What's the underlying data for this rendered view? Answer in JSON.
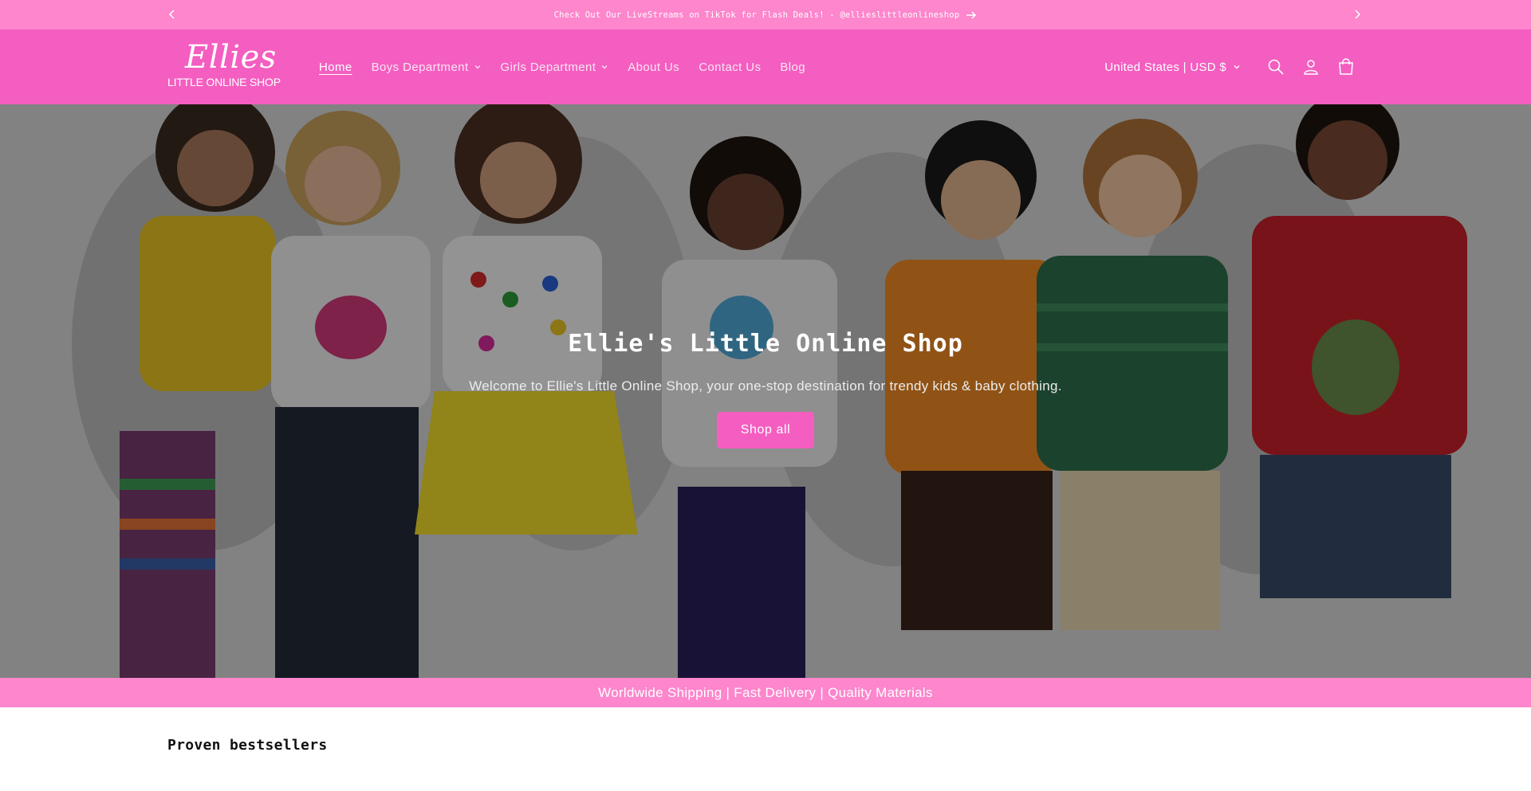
{
  "announcement": {
    "text": "Check Out Our LiveStreams on TikTok for Flash Deals! - @ellieslittleonlineshop",
    "prev_icon": "chevron-left-icon",
    "next_icon": "chevron-right-icon",
    "arrow_icon": "arrow-right-icon"
  },
  "header": {
    "logo_top": "Ellies",
    "logo_bottom": "LITTLE ONLINE SHOP",
    "nav": [
      {
        "label": "Home",
        "active": true
      },
      {
        "label": "Boys Department",
        "dropdown": true
      },
      {
        "label": "Girls Department",
        "dropdown": true
      },
      {
        "label": "About Us"
      },
      {
        "label": "Contact Us"
      },
      {
        "label": "Blog"
      }
    ],
    "locale": "United States | USD $",
    "icons": [
      "search-icon",
      "account-icon",
      "cart-icon"
    ]
  },
  "hero": {
    "title": "Ellie's Little Online Shop",
    "subtitle": "Welcome to Ellie's Little Online Shop, your one-stop destination for trendy kids & baby clothing.",
    "button": "Shop all"
  },
  "strip": {
    "text": "Worldwide Shipping | Fast Delivery | Quality Materials"
  },
  "section": {
    "title": "Proven bestsellers"
  },
  "colors": {
    "announcement_bg": "#fd86cc",
    "header_bg": "#f45ec0",
    "button_bg": "#f45ec0",
    "strip_bg": "#fd86cc"
  }
}
